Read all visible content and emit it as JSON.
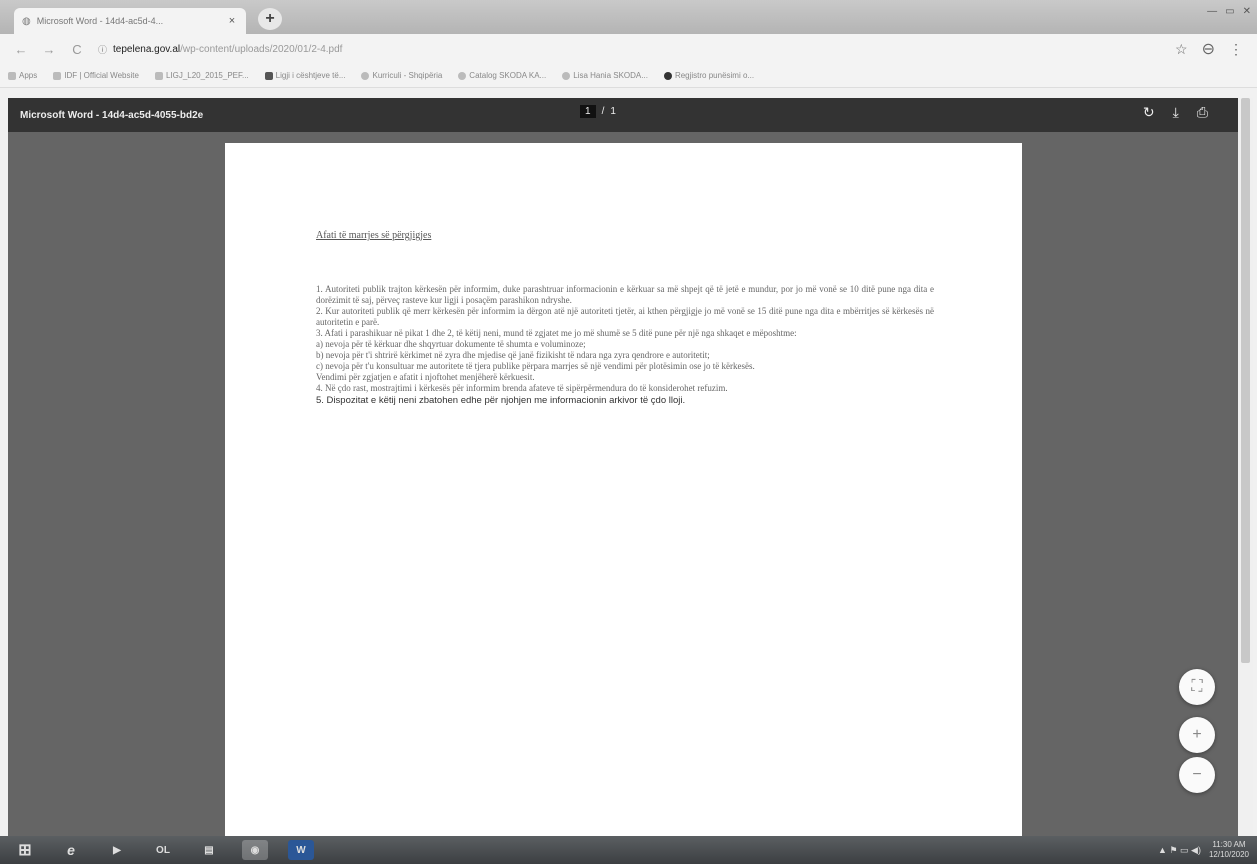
{
  "browser": {
    "tab_title": "Microsoft Word - 14d4-ac5d-4...",
    "tab_close": "×",
    "new_tab": "+",
    "url_domain": "tepelena.gov.al",
    "url_path": "/wp-content/uploads/2020/01/2-4.pdf",
    "back_icon": "←",
    "forward_icon": "→",
    "reload_icon": "C",
    "star_icon": "☆",
    "profile_icon": "⊖",
    "menu_icon": "⋮"
  },
  "bookmarks": [
    {
      "label": "Apps"
    },
    {
      "label": "IDF | Official Website"
    },
    {
      "label": "LIGJ_L20_2015_PEF..."
    },
    {
      "label": "Ligji i cështjeve të..."
    },
    {
      "label": "Kurriculi - Shqipëria"
    },
    {
      "label": "Catalog SKODA KA..."
    },
    {
      "label": "Lisa Hania SKODA..."
    },
    {
      "label": "Regjistro punësimi o..."
    }
  ],
  "pdf": {
    "title": "Microsoft Word - 14d4-ac5d-4055-bd2e",
    "current_page": "1",
    "page_separator": "/",
    "total_pages": "1",
    "rotate_icon": "↻",
    "download_icon": "⤓",
    "print_icon": "⎙",
    "fit_icon": "⛶",
    "zoom_in_icon": "+",
    "zoom_out_icon": "−"
  },
  "document": {
    "heading": "Afati të marrjes së përgjigjes",
    "paragraphs": [
      "1. Autoriteti publik trajton kërkesën për informim, duke parashtruar informacionin e kërkuar sa më shpejt që të jetë e mundur, por jo më vonë se 10 ditë pune nga dita e dorëzimit të saj, përveç rasteve kur ligji i posaçëm parashikon ndryshe.",
      "2. Kur autoriteti publik që merr kërkesën për informim ia dërgon atë një autoriteti tjetër, ai kthen përgjigje jo më vonë se 15 ditë pune nga dita e mbërritjes së kërkesës në autoritetin e parë.",
      "3. Afati i parashikuar në pikat 1 dhe 2, të këtij neni, mund të zgjatet me jo më shumë se 5 ditë pune për një nga shkaqet e mëposhtme:",
      "a) nevoja për të kërkuar dhe shqyrtuar dokumente të shumta e voluminoze;",
      "b) nevoja për t'i shtrirë kërkimet në zyra dhe mjedise që janë fizikisht të ndara nga zyra qendrore e autoritetit;",
      "c) nevoja për t'u konsultuar me autoritete të tjera publike përpara marrjes së një vendimi për plotësimin ose jo të kërkesës.",
      "Vendimi për zgjatjen e afatit i njoftohet menjëherë kërkuesit.",
      "4. Në çdo rast, mostrajtimi i kërkesës për informim brenda afateve të sipërpërmendura do të konsiderohet refuzim."
    ],
    "last_line": "5. Dispozitat e këtij neni zbatohen edhe për njohjen me informacionin arkivor të çdo lloji."
  },
  "taskbar": {
    "start_icon": "⊞",
    "apps": [
      "e",
      "▶",
      "OL",
      "▤",
      "◉",
      "W"
    ],
    "tray_icons": "▲ ⚑ ▭ ◀)",
    "time": "11:30 AM",
    "date": "12/10/2020"
  }
}
